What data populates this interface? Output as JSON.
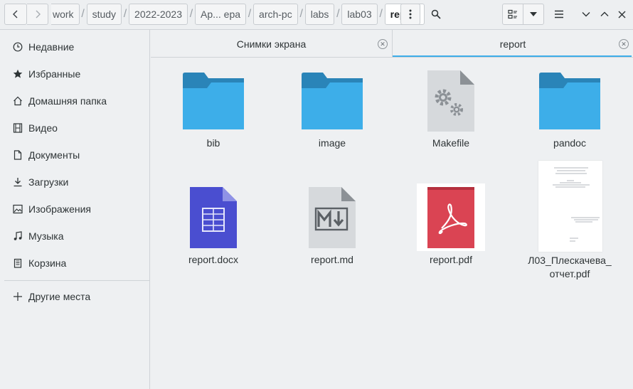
{
  "header": {
    "breadcrumbs": [
      "work",
      "study",
      "2022-2023",
      "Ар... ера",
      "arch-pc",
      "labs",
      "lab03",
      "report"
    ]
  },
  "sidebar": {
    "items": [
      {
        "label": "Недавние",
        "icon": "clock-icon"
      },
      {
        "label": "Избранные",
        "icon": "star-icon"
      },
      {
        "label": "Домашняя папка",
        "icon": "home-icon"
      },
      {
        "label": "Видео",
        "icon": "film-icon"
      },
      {
        "label": "Документы",
        "icon": "document-icon"
      },
      {
        "label": "Загрузки",
        "icon": "download-icon"
      },
      {
        "label": "Изображения",
        "icon": "image-icon"
      },
      {
        "label": "Музыка",
        "icon": "music-icon"
      },
      {
        "label": "Корзина",
        "icon": "trash-icon"
      }
    ],
    "other_places": "Другие места"
  },
  "tabs": [
    {
      "label": "Снимки экрана",
      "active": false
    },
    {
      "label": "report",
      "active": true
    }
  ],
  "files": [
    {
      "name": "bib",
      "type": "folder"
    },
    {
      "name": "image",
      "type": "folder"
    },
    {
      "name": "Makefile",
      "type": "makefile"
    },
    {
      "name": "pandoc",
      "type": "folder"
    },
    {
      "name": "report.docx",
      "type": "docx"
    },
    {
      "name": "report.md",
      "type": "markdown"
    },
    {
      "name": "report.pdf",
      "type": "pdf"
    },
    {
      "name": "Л03_Плескачева_\nотчет.pdf",
      "type": "pdf-thumbnail"
    }
  ],
  "colors": {
    "folder": "#3daee9",
    "folder_tab": "#2a84b8",
    "accent": "#3daee9",
    "docx": "#4a4ed0",
    "pdf": "#da4453"
  }
}
